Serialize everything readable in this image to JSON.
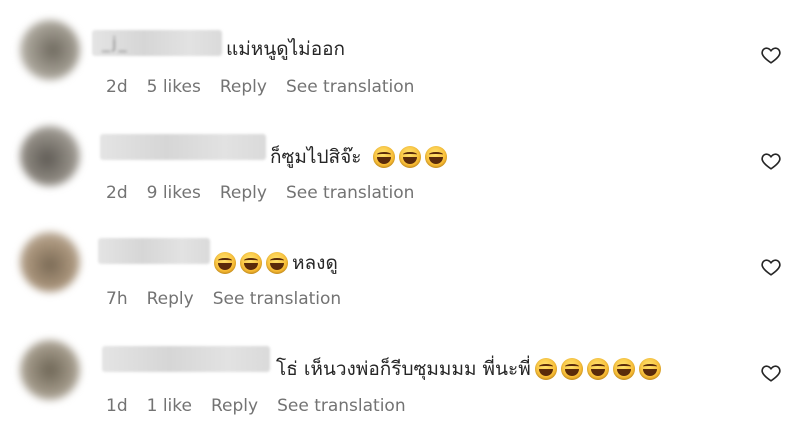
{
  "comments": [
    {
      "username": "_j_",
      "text": "แม่หนูดูไม่ออก",
      "emoji_count": 0,
      "emoji_before": false,
      "time": "2d",
      "likes": "5 likes",
      "reply": "Reply",
      "translate": "See translation",
      "icon": "heart-outline-icon"
    },
    {
      "username": "",
      "text": "ก็ซูมไปสิจ๊ะ",
      "emoji_count": 3,
      "emoji_before": false,
      "time": "2d",
      "likes": "9 likes",
      "reply": "Reply",
      "translate": "See translation",
      "icon": "heart-outline-icon"
    },
    {
      "username": "",
      "text": "หลงดู",
      "emoji_count": 3,
      "emoji_before": true,
      "time": "7h",
      "likes": "",
      "reply": "Reply",
      "translate": "See translation",
      "icon": "heart-outline-icon"
    },
    {
      "username": "",
      "text": "โธ่ เห็นวงพ่อก็รีบซุมมมม พี่นะพี่",
      "emoji_count": 5,
      "emoji_before": false,
      "time": "1d",
      "likes": "1 like",
      "reply": "Reply",
      "translate": "See translation",
      "icon": "heart-outline-icon"
    }
  ],
  "emoji_name": "face-with-tears-of-joy-emoji",
  "colors": {
    "text": "#262626",
    "meta": "#737373",
    "icon": "#262626"
  }
}
